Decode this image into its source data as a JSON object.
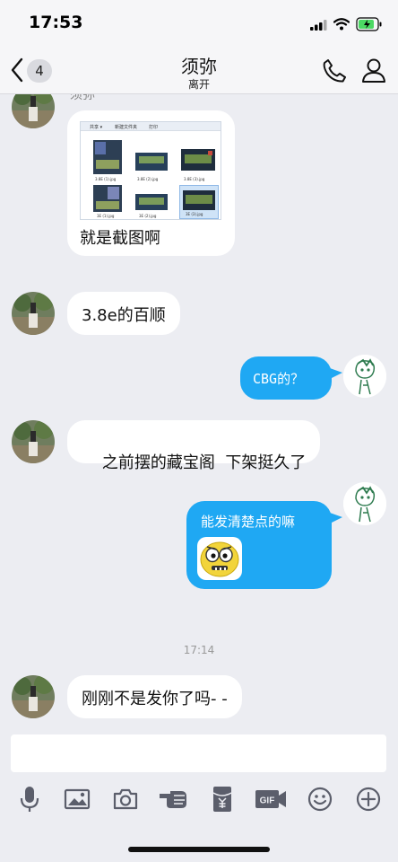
{
  "status": {
    "time": "17:53"
  },
  "header": {
    "back_count": "4",
    "title": "须弥",
    "subtitle": "离开"
  },
  "messages": {
    "sender_peek": "须弥",
    "image_caption": "就是截图啊",
    "explorer": {
      "menu": [
        "共享 ▾",
        "新建文件夹",
        "打印"
      ],
      "files": [
        "3.8E (1).jpg",
        "3.8E (2).jpg",
        "3.8E (3).jpg",
        "3E (1).jpg",
        "3E (2).jpg",
        "3E (3).jpg"
      ]
    },
    "m2": "3.8e的百顺",
    "m3": "CBG的？",
    "m4": "之前摆的藏宝阁  下架挺久了",
    "m5": "能发清楚点的嘛",
    "time_divider": "17:14",
    "m6": "刚刚不是发你了吗- -"
  },
  "input": {
    "placeholder": ""
  },
  "toolbar": [
    "mic-icon",
    "image-icon",
    "camera-icon",
    "poke-icon",
    "red-packet-icon",
    "gif-icon",
    "emoji-icon",
    "plus-icon"
  ],
  "colors": {
    "accent": "#1FA8F3",
    "background": "#ECEDF2",
    "bubble_in": "#FFFFFF"
  }
}
